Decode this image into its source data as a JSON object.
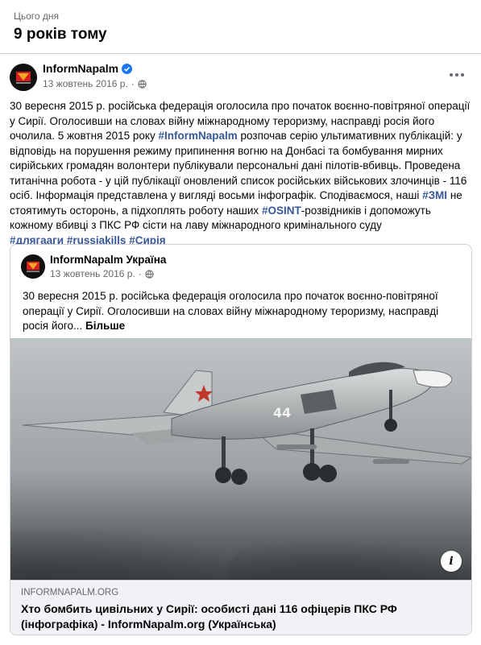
{
  "memory": {
    "label": "Цього дня",
    "title": "9 років тому"
  },
  "post": {
    "author": "InformNapalm",
    "date": "13 жовтень 2016 р.",
    "dot": "·",
    "text_before_link1": "30 вересня 2015 р. російська федерація оголосила про початок воєнно-повітряної операції у Сирії. Оголосивши на словах війну міжнародному тероризму, насправді росія його очолила. 5 жовтня 2015 року ",
    "link1": "#InformNapalm",
    "text_after_link1": " розпочав серію ультимативних публікацій: у відповідь на порушення режиму припинення вогню на Донбасі та бомбування мирних сирійських громадян волонтери публікували персональні дані пілотів-вбивць. Проведена титанічна робота - у цій публікації оновлений список російських військових злочинців - 116 осіб. Інформація представлена у вигляді восьми інфографік. Сподіваємося, наші ",
    "link2": "#ЗМІ",
    "text_after_link2": " не стоятимуть осторонь, а підхоплять роботу наших ",
    "link3": "#OSINT",
    "text_after_link3": "-розвідників і допоможуть кожному вбивці з ПКС РФ сісти на лаву міжнародного кримінального суду",
    "hashtags": [
      "#длягааги",
      "#russiakills",
      "#Сирія"
    ]
  },
  "shared": {
    "author": "InformNapalm Україна",
    "date": "13 жовтень 2016 р.",
    "dot": "·",
    "text": "30 вересня 2015 р. російська федерація оголосила про початок воєнно-повітряної операції у Сирії. Оголосивши на словах війну міжнародному тероризму, насправді росія його... ",
    "see_more": "Більше",
    "image_marking": "44",
    "link": {
      "domain": "INFORMNAPALM.ORG",
      "title": "Хто бомбить цивільних у Сирії: особисті дані 116 офіцерів ПКС РФ (інфографіка) - InformNapalm.org (Українська)"
    }
  },
  "icons": {
    "verified": "verified-badge-icon",
    "globe": "globe-icon",
    "more": "more-options-icon",
    "info": "info-icon"
  },
  "colors": {
    "link": "#385898",
    "secondary_text": "#65676b",
    "verified": "#1877f2"
  }
}
